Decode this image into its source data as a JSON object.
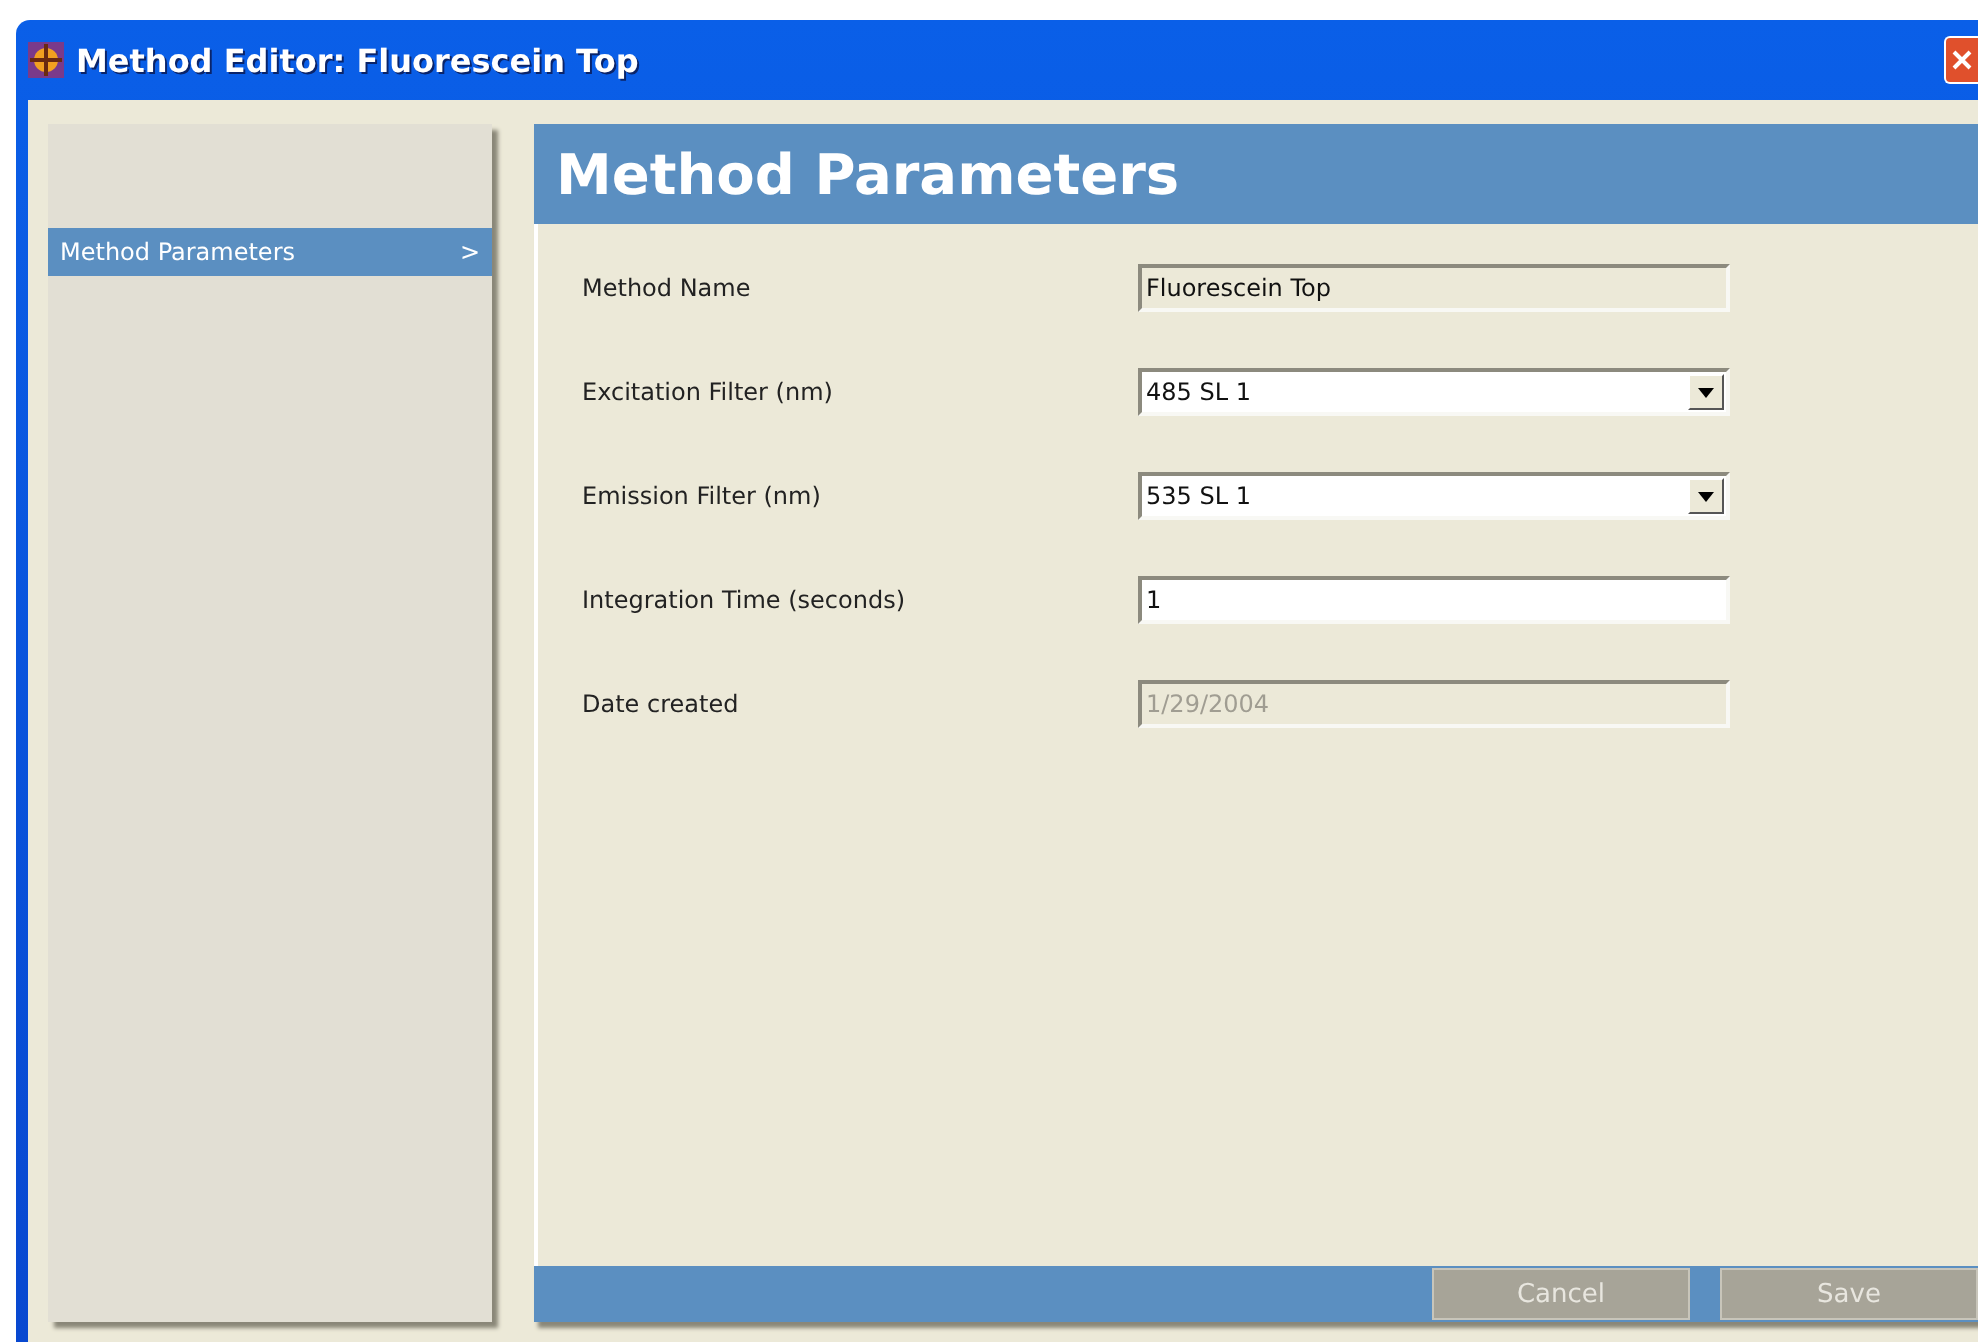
{
  "window": {
    "title": "Method Editor: Fluorescein Top"
  },
  "sidebar": {
    "items": [
      {
        "label": "Method Parameters",
        "chevron": ">",
        "selected": true
      }
    ]
  },
  "panel": {
    "title": "Method Parameters",
    "fields": [
      {
        "label": "Method Name",
        "kind": "text",
        "value": "Fluorescein Top",
        "editable": false,
        "disabled": false
      },
      {
        "label": "Excitation Filter (nm)",
        "kind": "dropdown",
        "value": "485 SL 1",
        "editable": true,
        "disabled": false
      },
      {
        "label": "Emission Filter (nm)",
        "kind": "dropdown",
        "value": "535 SL 1",
        "editable": true,
        "disabled": false
      },
      {
        "label": "Integration Time (seconds)",
        "kind": "text",
        "value": "1",
        "editable": true,
        "disabled": false
      },
      {
        "label": "Date created",
        "kind": "text",
        "value": "1/29/2004",
        "editable": false,
        "disabled": true
      }
    ]
  },
  "buttons": [
    {
      "label": "Cancel",
      "disabled": true
    },
    {
      "label": "Save",
      "disabled": true
    }
  ]
}
